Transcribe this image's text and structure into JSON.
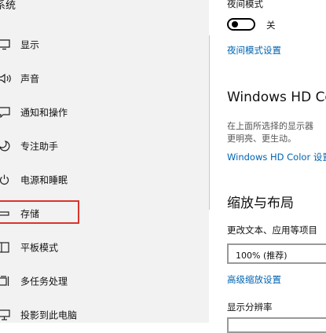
{
  "sidebar": {
    "title": "系统",
    "items": [
      {
        "label": "显示"
      },
      {
        "label": "声音"
      },
      {
        "label": "通知和操作"
      },
      {
        "label": "专注助手"
      },
      {
        "label": "电源和睡眠"
      },
      {
        "label": "存储"
      },
      {
        "label": "平板模式"
      },
      {
        "label": "多任务处理"
      },
      {
        "label": "投影到此电脑"
      }
    ]
  },
  "main": {
    "night_mode": {
      "heading": "夜间模式",
      "toggle_state": "关",
      "settings_link": "夜间模式设置"
    },
    "hdr": {
      "heading": "Windows HD Co",
      "description_line1": "在上面所选择的显示器",
      "description_line2": "更明亮、更生动。",
      "settings_link": "Windows HD Color 设置"
    },
    "scale": {
      "heading": "缩放与布局",
      "text_size_label": "更改文本、应用等项目",
      "scale_value": "100% (推荐)",
      "advanced_link": "高级缩放设置",
      "resolution_label": "显示分辨率"
    }
  },
  "colors": {
    "accent": "#0063b1",
    "highlight": "#d9342b",
    "sidebar_bg": "#f2f2f2"
  }
}
